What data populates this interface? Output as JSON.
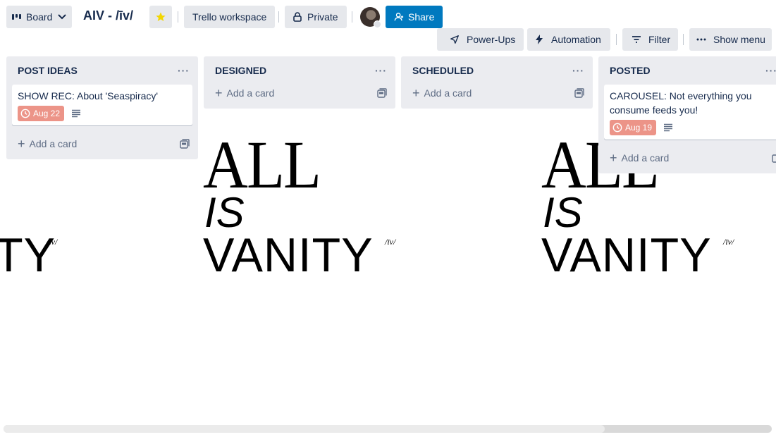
{
  "header": {
    "view_label": "Board",
    "board_title": "AIV - /īv/",
    "workspace_label": "Trello workspace",
    "visibility_label": "Private",
    "share_label": "Share",
    "powerups_label": "Power-Ups",
    "automation_label": "Automation",
    "filter_label": "Filter",
    "menu_label": "Show menu"
  },
  "background": {
    "line1": "ALL",
    "line2": "IS",
    "line3": "VANITY",
    "sup": "/īv/",
    "fragment": "TY"
  },
  "lists": [
    {
      "title": "POST IDEAS",
      "cards": [
        {
          "title": "SHOW REC: About 'Seaspiracy'",
          "due": "Aug 22"
        }
      ],
      "add_label": "Add a card"
    },
    {
      "title": "DESIGNED",
      "cards": [],
      "add_label": "Add a card"
    },
    {
      "title": "SCHEDULED",
      "cards": [],
      "add_label": "Add a card"
    },
    {
      "title": "POSTED",
      "cards": [
        {
          "title": "CAROUSEL: Not everything you consume feeds you!",
          "due": "Aug 19"
        }
      ],
      "add_label": "Add a card"
    }
  ],
  "colors": {
    "share_bg": "#0079bf",
    "due_bg": "#ec9488",
    "list_bg": "#ebecf0",
    "star": "#f2d600"
  },
  "icons": {
    "board": "board-icon",
    "star": "star-icon",
    "lock": "lock-icon",
    "share": "add-person-icon",
    "powerups": "rocket-icon",
    "automation": "bolt-icon",
    "filter": "filter-icon",
    "menu": "ellipsis-icon",
    "due": "clock-icon",
    "desc": "description-icon",
    "template": "card-template-icon"
  }
}
